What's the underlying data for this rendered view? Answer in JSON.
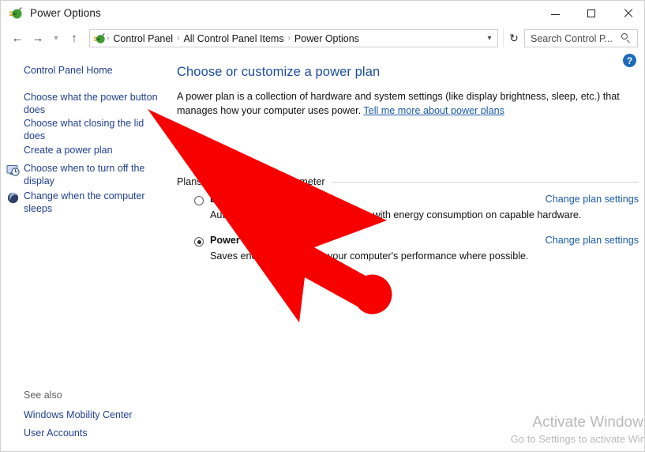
{
  "window": {
    "title": "Power Options",
    "icon": "power-plug-icon",
    "buttons": {
      "minimize": "minimize-icon",
      "maximize": "maximize-icon",
      "close": "close-icon"
    }
  },
  "navbar": {
    "back": "back-arrow-icon",
    "forward": "forward-arrow-icon",
    "recent": "chevron-down-icon",
    "up": "up-arrow-icon",
    "breadcrumbs": [
      "Control Panel",
      "All Control Panel Items",
      "Power Options"
    ],
    "separator": "›",
    "dropdown": "chevron-down-icon",
    "refresh": "↻",
    "search_placeholder": "Search Control P..."
  },
  "help": {
    "label": "?"
  },
  "sidebar": {
    "items": [
      {
        "label": "Control Panel Home",
        "icon": null
      },
      {
        "label": "Choose what the power button does",
        "icon": null
      },
      {
        "label": "Choose what closing the lid does",
        "icon": null
      },
      {
        "label": "Create a power plan",
        "icon": null
      },
      {
        "label": "Choose when to turn off the display",
        "icon": "display-clock-icon"
      },
      {
        "label": "Change when the computer sleeps",
        "icon": "sleep-moon-icon"
      }
    ],
    "see_also_label": "See also",
    "see_also": [
      "Windows Mobility Center",
      "User Accounts"
    ]
  },
  "main": {
    "heading": "Choose or customize a power plan",
    "description_part1": "A power plan is a collection of hardware and system settings (like display brightness, sleep, etc.) that manages how your computer uses power. ",
    "description_link": "Tell me more about power plans",
    "group_label": "Plans shown on the battery meter",
    "plans": [
      {
        "name": "Balanced (recommended)",
        "description": "Automatically balances performance with energy consumption on capable hardware.",
        "change_link": "Change plan settings",
        "selected": false
      },
      {
        "name": "Power saver",
        "description": "Saves energy by reducing your computer's performance where possible.",
        "change_link": "Change plan settings",
        "selected": true
      }
    ]
  },
  "watermark": {
    "line1": "Activate Windows",
    "line2": "Go to Settings to activate Windows."
  },
  "colors": {
    "heading": "#1a4d9e",
    "link": "#1a5ba8",
    "sidebar_link": "#1f3f8f",
    "cursor": "#f60000",
    "help_badge": "#1c6bba"
  }
}
